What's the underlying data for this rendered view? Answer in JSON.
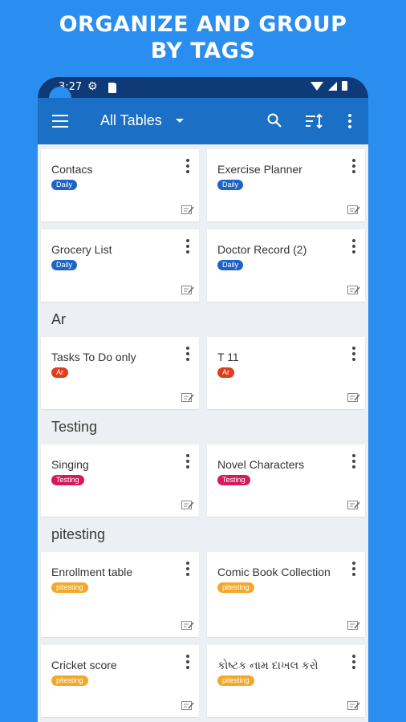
{
  "headline": {
    "line1": "ORGANIZE AND GROUP",
    "line2": "BY TAGS"
  },
  "status_bar": {
    "time": "3:27"
  },
  "app_bar": {
    "title": "All Tables"
  },
  "groups": [
    {
      "title": "",
      "cards": [
        {
          "name": "Contacs",
          "tag": "Daily",
          "tag_color": "#1e63c6"
        },
        {
          "name": "Exercise Planner",
          "tag": "Daily",
          "tag_color": "#1e63c6"
        },
        {
          "name": "Grocery List",
          "tag": "Daily",
          "tag_color": "#1e63c6"
        },
        {
          "name": "Doctor Record (2)",
          "tag": "Daily",
          "tag_color": "#1e63c6"
        }
      ]
    },
    {
      "title": "Ar",
      "cards": [
        {
          "name": "Tasks To Do only",
          "tag": "Ar",
          "tag_color": "#e23d1a"
        },
        {
          "name": "T 11",
          "tag": "Ar",
          "tag_color": "#e23d1a"
        }
      ]
    },
    {
      "title": "Testing",
      "cards": [
        {
          "name": "Singing",
          "tag": "Testing",
          "tag_color": "#d8195a"
        },
        {
          "name": "Novel Characters",
          "tag": "Testing",
          "tag_color": "#d8195a"
        }
      ]
    },
    {
      "title": "pitesting",
      "cards": [
        {
          "name": " Enrollment table",
          "tag": "pitesting",
          "tag_color": "#f4a82a"
        },
        {
          "name": "Comic Book Collection",
          "tag": "pitesting",
          "tag_color": "#f4a82a"
        },
        {
          "name": "Cricket score",
          "tag": "pitesting",
          "tag_color": "#f4a82a"
        },
        {
          "name": "કોષ્ટક નામ દાખલ કરો",
          "tag": "pitesting",
          "tag_color": "#f4a82a"
        }
      ]
    }
  ],
  "icons": {
    "menu": "hamburger-menu-icon",
    "dropdown": "chevron-down-icon",
    "search": "search-icon",
    "sort": "sort-icon",
    "overflow": "more-vert-icon",
    "card_menu": "more-vert-icon",
    "card_edit": "edit-note-icon"
  },
  "colors": {
    "background": "#2a8ef0",
    "app_bar": "#1b6fc4",
    "status_bar": "#0e3a78"
  }
}
